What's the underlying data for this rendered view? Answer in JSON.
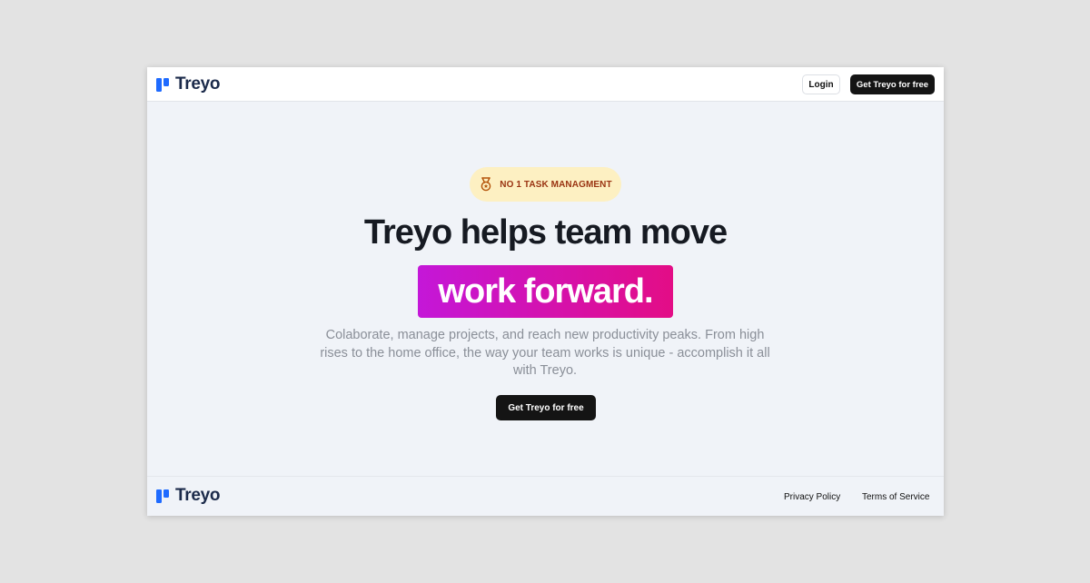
{
  "navbar": {
    "brand": {
      "name": "Treyo",
      "icon": "treyo-logo-icon"
    },
    "login_label": "Login",
    "cta_label": "Get Treyo for free"
  },
  "hero": {
    "badge": {
      "icon": "medal-icon",
      "text": "NO 1 TASK MANAGMENT"
    },
    "headline": "Treyo helps team move",
    "highlight": "work forward.",
    "description": "Colaborate, manage projects, and reach new productivity peaks. From high rises to the home office, the way your team works is unique - accomplish it all with Treyo.",
    "cta_label": "Get Treyo for free"
  },
  "footer": {
    "brand": {
      "name": "Treyo",
      "icon": "treyo-logo-icon"
    },
    "links": [
      "Privacy Policy",
      "Terms of Service"
    ]
  },
  "colors": {
    "page_bg": "#e3e3e3",
    "hero_bg": "#f0f3f8",
    "brand_blue": "#1f6bff",
    "brand_dark": "#1b2a4a",
    "button_dark": "#141414",
    "badge_bg": "#fdf0c2",
    "badge_text": "#9a3412",
    "highlight_gradient_start": "#c417d8",
    "highlight_gradient_end": "#e30d86",
    "subtext": "#8a8f98"
  }
}
